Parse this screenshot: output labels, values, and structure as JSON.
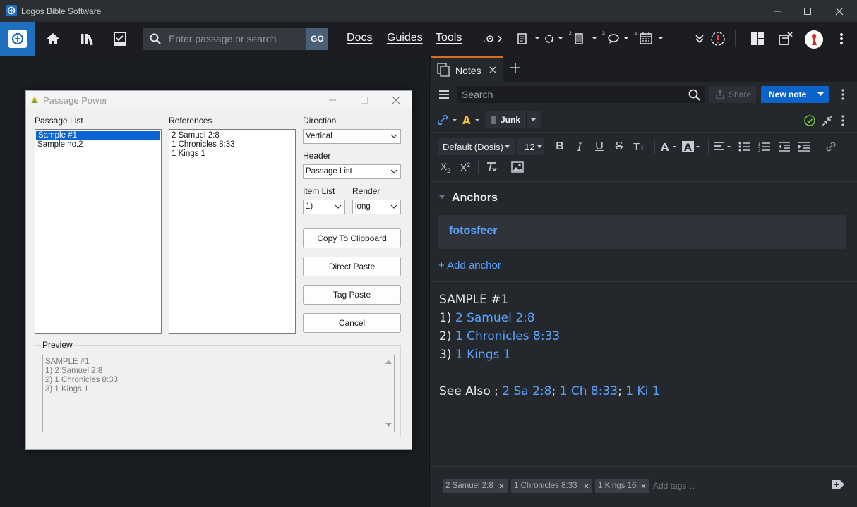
{
  "window": {
    "title": "Logos Bible Software"
  },
  "toolbar": {
    "search_placeholder": "Enter passage or search",
    "go_label": "GO",
    "docs": "Docs",
    "guides": "Guides",
    "tools": "Tools",
    "tool_sequence_1": "²",
    "tool_sequence_2": "³",
    "tool_sequence_3": "⁴"
  },
  "dialog": {
    "title": "Passage Power",
    "passage_list_label": "Passage List",
    "passage_list": [
      "Sample #1",
      "Sample no.2"
    ],
    "references_label": "References",
    "references": [
      "2 Samuel 2:8",
      "1 Chronicles 8:33",
      "1 Kings 1"
    ],
    "direction_label": "Direction",
    "direction_value": "Vertical",
    "header_label": "Header",
    "header_value": "Passage List",
    "item_list_label": "Item List",
    "item_list_value": "1)",
    "render_label": "Render",
    "render_value": "long",
    "copy_button": "Copy To Clipboard",
    "direct_paste_button": "Direct Paste",
    "tag_paste_button": "Tag Paste",
    "cancel_button": "Cancel",
    "preview_label": "Preview",
    "preview_lines": [
      "SAMPLE #1",
      "1) 2 Samuel 2:8",
      "2) 1 Chronicles 8:33",
      "3) 1 Kings 1"
    ]
  },
  "notes": {
    "tab_label": "Notes",
    "search_placeholder": "Search",
    "share_label": "Share",
    "new_note_label": "New note",
    "notebook_label": "Junk",
    "font_family": "Default (Dosis)",
    "font_size": "12",
    "anchors_label": "Anchors",
    "anchor_item": "fotosfeer",
    "add_anchor": "+ Add anchor",
    "body": {
      "heading": "SAMPLE #1",
      "items": [
        {
          "num": "1) ",
          "ref": "2 Samuel 2:8"
        },
        {
          "num": "2) ",
          "ref": "1 Chronicles 8:33"
        },
        {
          "num": "3) ",
          "ref": "1 Kings 1"
        }
      ],
      "see_also_label": "See Also ; ",
      "see_also_refs": [
        "2 Sa 2:8",
        "1 Ch 8:33",
        "1 Ki 1"
      ],
      "see_also_sep": "; "
    },
    "tags": [
      "2 Samuel 2:8",
      "1 Chronicles 8:33",
      "1 Kings 16"
    ],
    "tags_placeholder": "Add tags…"
  },
  "colors": {
    "accent": "#0a63c9",
    "link": "#5aa4ff",
    "tab_highlight": "#d46b27",
    "success": "#6fbf3a"
  }
}
